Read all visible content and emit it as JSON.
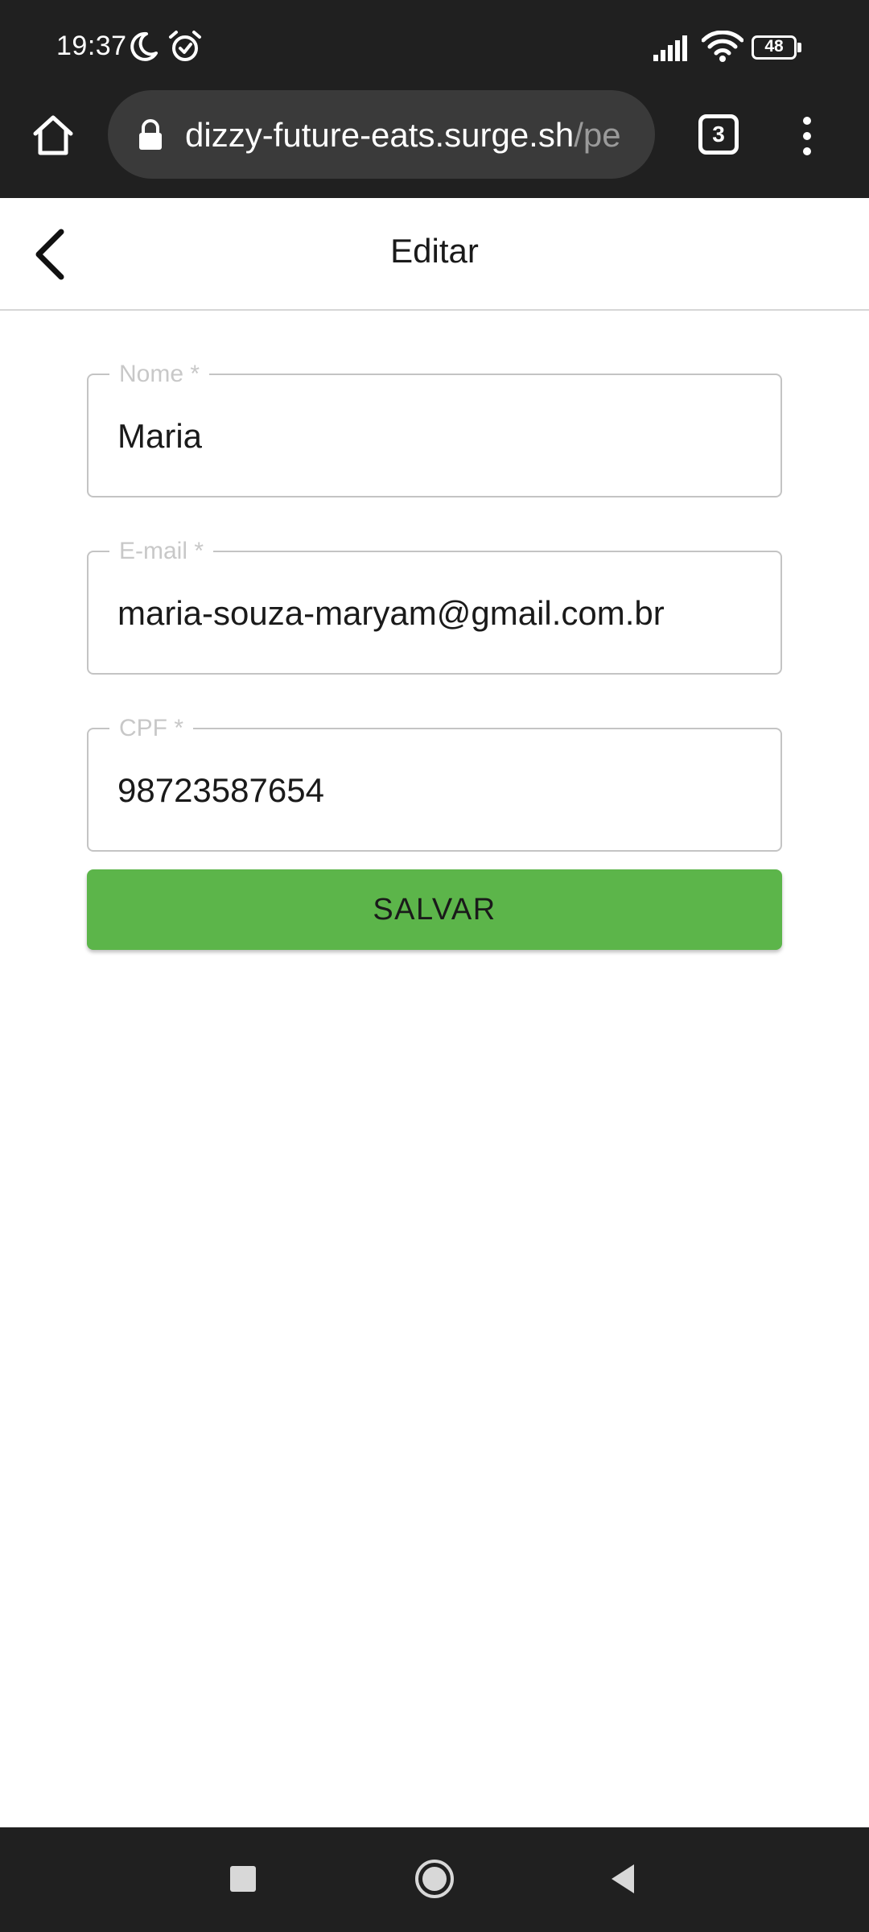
{
  "status_bar": {
    "time": "19:37",
    "battery": "48",
    "icons": [
      "moon-icon",
      "alarm-icon",
      "signal-icon",
      "wifi-icon",
      "battery-icon"
    ]
  },
  "browser": {
    "url_main": "dizzy-future-eats.surge.sh",
    "url_rest": "/pe",
    "tab_count": "3",
    "icons": [
      "home-icon",
      "lock-icon",
      "tabs-icon",
      "more-vert-icon"
    ]
  },
  "header": {
    "title": "Editar",
    "back_icon": "chevron-left-icon"
  },
  "form": {
    "name": {
      "label": "Nome *",
      "value": "Maria"
    },
    "email": {
      "label": "E-mail *",
      "value": "maria-souza-maryam@gmail.com.br"
    },
    "cpf": {
      "label": "CPF *",
      "value": "98723587654"
    },
    "save_label": "SALVAR"
  },
  "colors": {
    "system_bar": "#202020",
    "url_pill": "#3a3a3a",
    "button": "#5cb54a",
    "field_border": "#c4c4c4",
    "label": "#c8c8c8"
  },
  "nav_bar": {
    "icons": [
      "recents-square-icon",
      "home-circle-icon",
      "back-triangle-icon"
    ]
  }
}
